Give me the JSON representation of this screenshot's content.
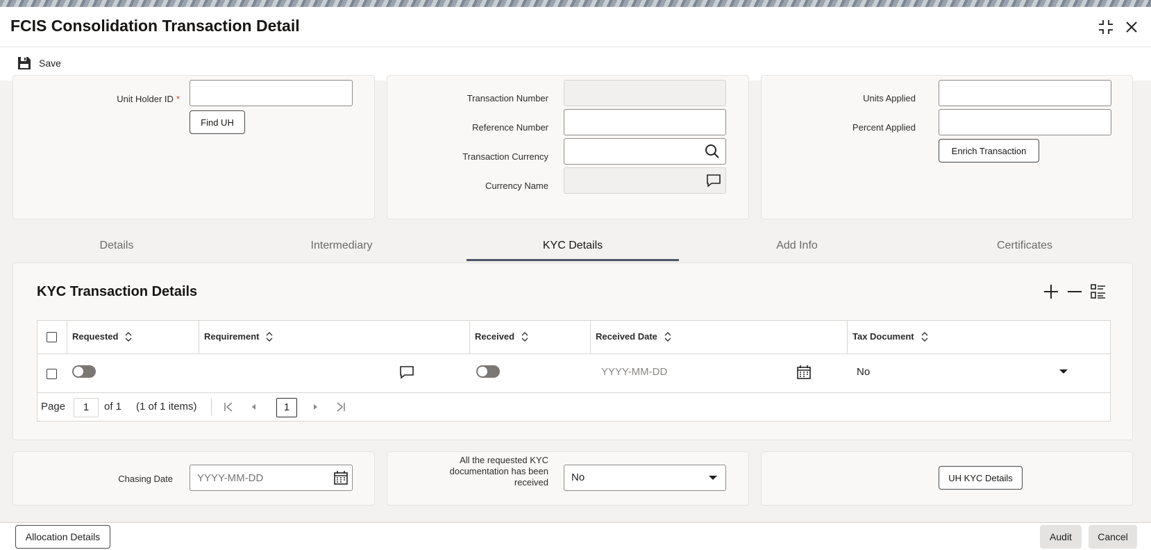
{
  "window": {
    "title": "FCIS Consolidation Transaction Detail"
  },
  "toolbar": {
    "save_label": "Save"
  },
  "unit_holder": {
    "label": "Unit Holder ID",
    "required_mark": "*",
    "value": "",
    "find_button": "Find UH"
  },
  "transaction": {
    "number_label": "Transaction Number",
    "number_value": "",
    "reference_label": "Reference Number",
    "reference_value": "",
    "currency_label": "Transaction Currency",
    "currency_value": "",
    "currency_name_label": "Currency Name",
    "currency_name_value": ""
  },
  "units": {
    "units_applied_label": "Units Applied",
    "units_applied_value": "",
    "percent_applied_label": "Percent Applied",
    "percent_applied_value": "",
    "enrich_button": "Enrich Transaction"
  },
  "tabs": [
    {
      "label": "Details",
      "active": false
    },
    {
      "label": "Intermediary",
      "active": false
    },
    {
      "label": "KYC Details",
      "active": true
    },
    {
      "label": "Add Info",
      "active": false
    },
    {
      "label": "Certificates",
      "active": false
    }
  ],
  "kyc": {
    "title": "KYC Transaction Details",
    "columns": [
      "Requested",
      "Requirement",
      "Received",
      "Received Date",
      "Tax Document"
    ],
    "rows": [
      {
        "requested": false,
        "requirement": "",
        "received": false,
        "received_date_placeholder": "YYYY-MM-DD",
        "tax_document": "No"
      }
    ],
    "pagination": {
      "page_label": "Page",
      "page_value": "1",
      "of_label": "of 1",
      "items_label": "(1 of 1 items)",
      "current_page": "1"
    }
  },
  "chasing": {
    "label": "Chasing Date",
    "placeholder": "YYYY-MM-DD",
    "docs_received_label": "All the requested KYC documentation has been received",
    "docs_received_value": "No",
    "uh_kyc_button": "UH KYC Details"
  },
  "footer": {
    "allocation_button": "Allocation Details",
    "audit_button": "Audit",
    "cancel_button": "Cancel"
  },
  "colors": {
    "accent_tab_underline": "#4a5566",
    "required": "#c74634",
    "panel_bg": "#f9f8f7"
  }
}
